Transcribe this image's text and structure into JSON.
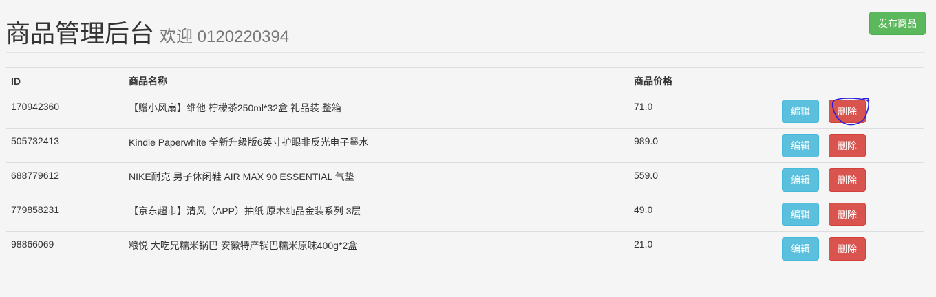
{
  "header": {
    "title": "商品管理后台",
    "welcome": "欢迎 0120220394",
    "publish_label": "发布商品"
  },
  "table": {
    "columns": [
      "ID",
      "商品名称",
      "商品价格"
    ],
    "rows": [
      {
        "id": "170942360",
        "name": "【赠小风扇】维他 柠檬茶250ml*32盒 礼品装 整箱",
        "price": "71.0",
        "edit": "编辑",
        "delete": "删除"
      },
      {
        "id": "505732413",
        "name": "Kindle Paperwhite 全新升级版6英寸护眼非反光电子墨水",
        "price": "989.0",
        "edit": "编辑",
        "delete": "删除"
      },
      {
        "id": "688779612",
        "name": "NIKE耐克 男子休闲鞋 AIR MAX 90 ESSENTIAL 气垫",
        "price": "559.0",
        "edit": "编辑",
        "delete": "删除"
      },
      {
        "id": "779858231",
        "name": "【京东超市】清风（APP）抽纸 原木纯品金装系列 3层",
        "price": "49.0",
        "edit": "编辑",
        "delete": "删除"
      },
      {
        "id": "98866069",
        "name": "粮悦 大吃兄糯米锅巴 安徽特产锅巴糯米原味400g*2盒",
        "price": "21.0",
        "edit": "编辑",
        "delete": "删除"
      }
    ]
  },
  "colors": {
    "success": "#5cb85c",
    "info": "#5bc0de",
    "danger": "#d9534f",
    "annotation": "#2a1fd6"
  }
}
